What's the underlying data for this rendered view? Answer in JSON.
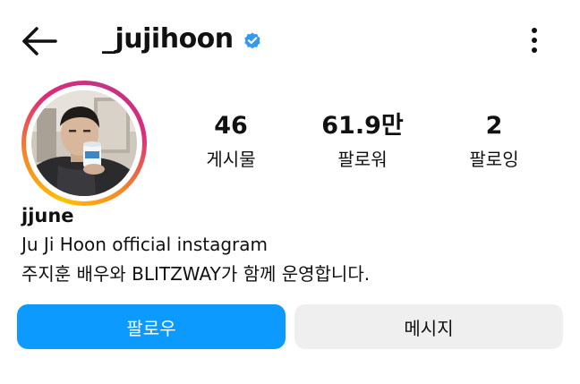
{
  "header": {
    "back_icon": "arrow-left-icon",
    "username": "_jujihoon",
    "verified_icon": "verified-badge-icon",
    "more_icon": "more-vertical-icon"
  },
  "profile": {
    "avatar_icon": "profile-photo",
    "stats": [
      {
        "value": "46",
        "label": "게시물"
      },
      {
        "value": "61.9만",
        "label": "팔로워"
      },
      {
        "value": "2",
        "label": "팔로잉"
      }
    ],
    "display_name": "jjune",
    "bio": [
      "Ju Ji Hoon official instagram",
      "주지훈 배우와 BLITZWAY가 함께 운영합니다."
    ]
  },
  "actions": {
    "follow_label": "팔로우",
    "message_label": "메시지"
  },
  "colors": {
    "accent": "#0c9aff",
    "verified": "#3897f0",
    "secondary_button": "#efefef"
  }
}
